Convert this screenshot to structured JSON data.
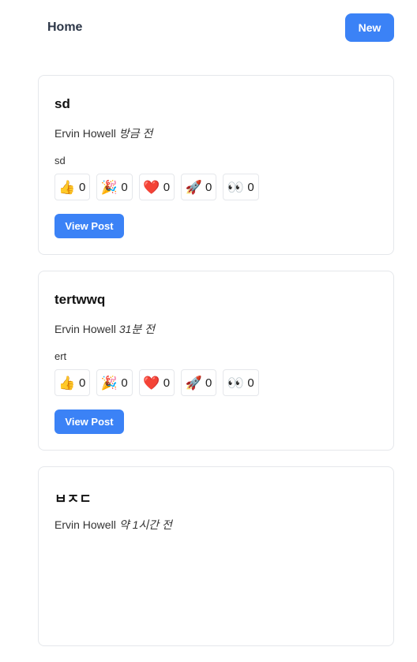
{
  "header": {
    "home_label": "Home",
    "new_label": "New"
  },
  "posts": [
    {
      "title": "sd",
      "author": "Ervin Howell",
      "time": "방금 전",
      "body": "sd",
      "reactions": [
        {
          "icon": "thumbs-up-icon",
          "glyph": "👍",
          "count": "0"
        },
        {
          "icon": "party-popper-icon",
          "glyph": "🎉",
          "count": "0"
        },
        {
          "icon": "heart-icon",
          "glyph": "❤️",
          "count": "0"
        },
        {
          "icon": "rocket-icon",
          "glyph": "🚀",
          "count": "0"
        },
        {
          "icon": "eyes-icon",
          "glyph": "👀",
          "count": "0"
        }
      ],
      "view_label": "View Post"
    },
    {
      "title": "tertwwq",
      "author": "Ervin Howell",
      "time": "31분 전",
      "body": "ert",
      "reactions": [
        {
          "icon": "thumbs-up-icon",
          "glyph": "👍",
          "count": "0"
        },
        {
          "icon": "party-popper-icon",
          "glyph": "🎉",
          "count": "0"
        },
        {
          "icon": "heart-icon",
          "glyph": "❤️",
          "count": "0"
        },
        {
          "icon": "rocket-icon",
          "glyph": "🚀",
          "count": "0"
        },
        {
          "icon": "eyes-icon",
          "glyph": "👀",
          "count": "0"
        }
      ],
      "view_label": "View Post"
    },
    {
      "title": "ㅂㅈㄷ",
      "author": "Ervin Howell",
      "time": "약 1시간 전",
      "body": "",
      "reactions": [],
      "view_label": ""
    }
  ]
}
